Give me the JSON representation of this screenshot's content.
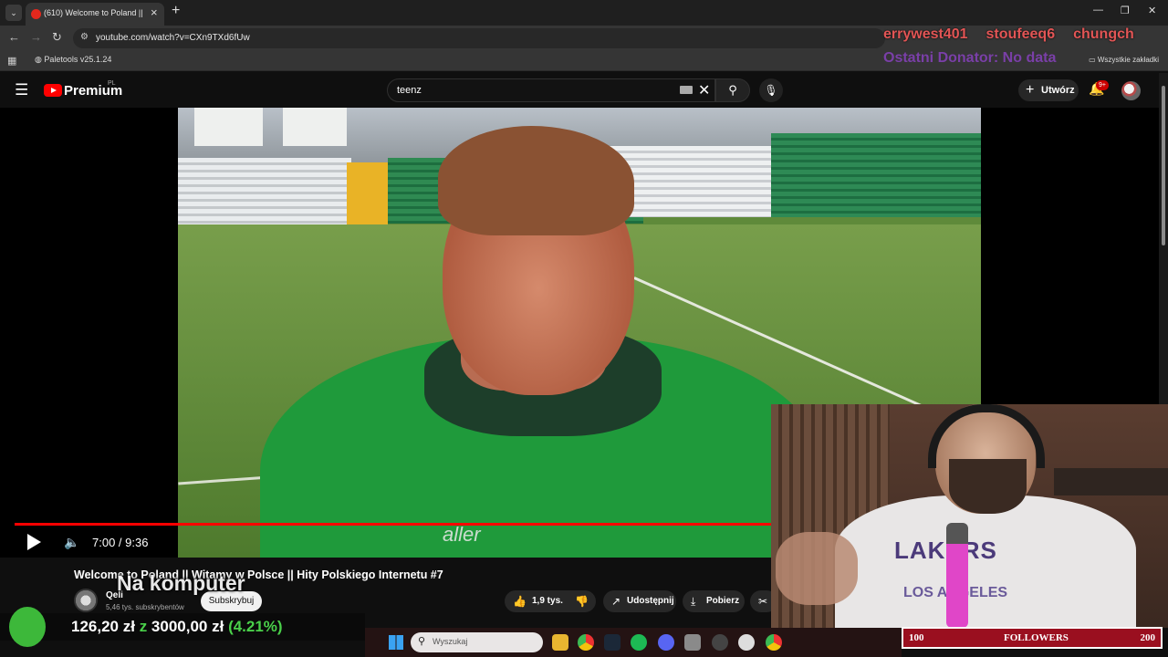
{
  "browser": {
    "tab_title": "(610) Welcome to Poland || Wit",
    "url": "youtube.com/watch?v=CXn9TXd6fUw",
    "bookmark": "Paletools v25.1.24",
    "all_bookmarks": "Wszystkie zakładki"
  },
  "overlay": {
    "ticker": [
      "errywest401",
      "stoufeeq6",
      "chungch"
    ],
    "donator": "Ostatni Donator: No data",
    "caption": "Na komputer",
    "goal": {
      "current": "126,20 zł",
      "sep": "z",
      "target": "3000,00 zł",
      "percent": "(4.21%)",
      "progress": 0.0421
    },
    "followers": {
      "min": "100",
      "label": "FOLLOWERS",
      "max": "200"
    }
  },
  "youtube": {
    "brand": "Premium",
    "region": "PL",
    "search_value": "teenz",
    "create_label": "Utwórz",
    "notifications": "9+",
    "player": {
      "time": "7:00 / 9:36",
      "progress": 0.7292,
      "watermark": "aller"
    },
    "video_title": "Welcome to Poland || Witamy w Polsce || Hity Polskiego Internetu #7",
    "channel": {
      "name": "Qeli",
      "subs": "5,46 tys. subskrybentów",
      "subscribe": "Subskrybuj"
    },
    "actions": {
      "likes": "1,9 tys.",
      "share": "Udostępnij",
      "download": "Pobierz"
    }
  },
  "taskbar": {
    "search_placeholder": "Wyszukaj"
  },
  "colors": {
    "yt_red": "#ff0000",
    "goal_green": "#4ad04a",
    "followers_red": "#9a0f1f"
  }
}
